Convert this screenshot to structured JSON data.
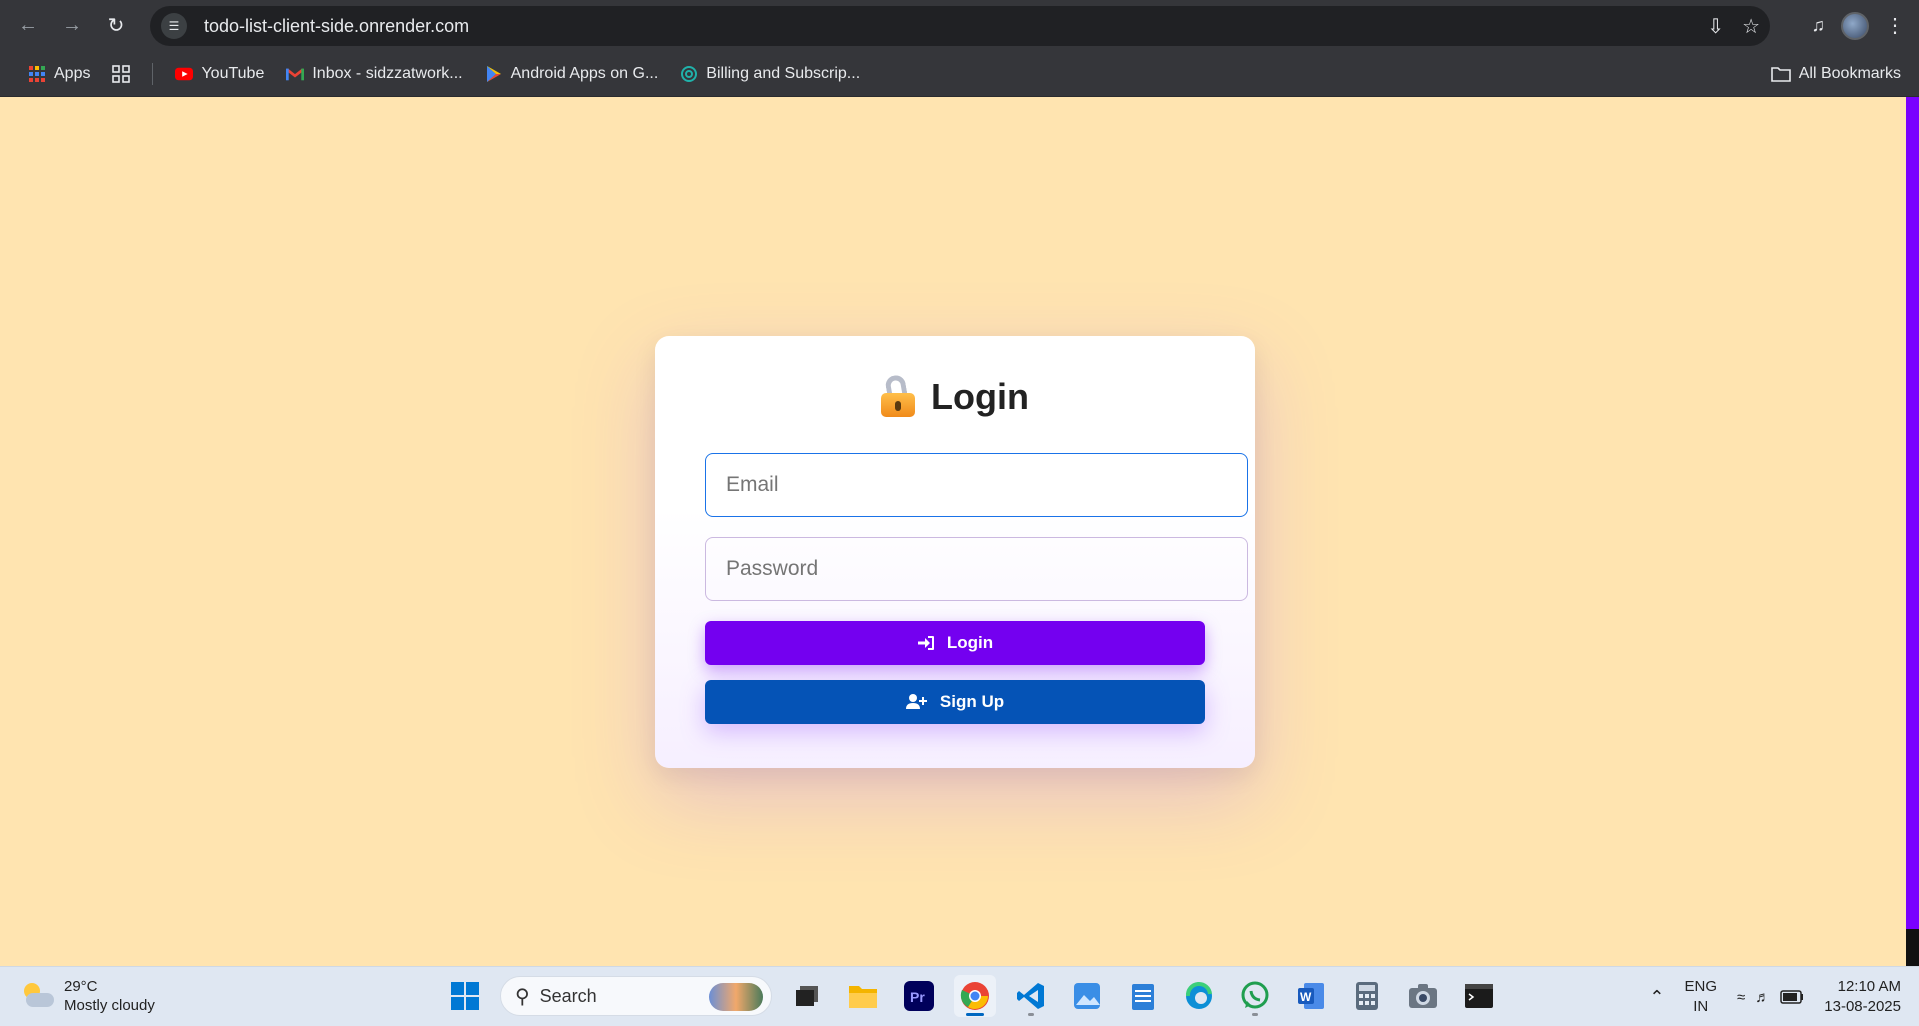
{
  "browser": {
    "url": "todo-list-client-side.onrender.com",
    "bookmarks": [
      {
        "label": "Apps",
        "icon": "apps-grid-icon"
      },
      {
        "label": "YouTube",
        "icon": "youtube-icon"
      },
      {
        "label": "Inbox - sidzzatwork...",
        "icon": "gmail-icon"
      },
      {
        "label": "Android Apps on G...",
        "icon": "play-store-icon"
      },
      {
        "label": "Billing and Subscrip...",
        "icon": "billing-icon"
      }
    ],
    "all_bookmarks": "All Bookmarks"
  },
  "login": {
    "title": "Login",
    "email_placeholder": "Email",
    "password_placeholder": "Password",
    "login_label": "Login",
    "signup_label": "Sign Up",
    "colors": {
      "login_button": "#7400f0",
      "signup_button": "#0553b6",
      "background": "#ffe4b0"
    }
  },
  "taskbar": {
    "weather_temp": "29°C",
    "weather_desc": "Mostly cloudy",
    "search_label": "Search",
    "lang_top": "ENG",
    "lang_bottom": "IN",
    "time": "12:10 AM",
    "date": "13-08-2025"
  }
}
